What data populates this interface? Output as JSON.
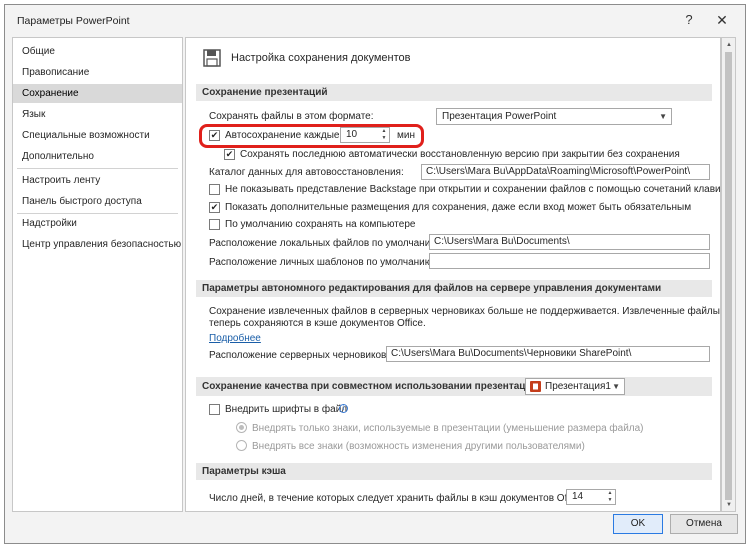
{
  "window": {
    "title": "Параметры PowerPoint",
    "help": "?",
    "close": "✕"
  },
  "sidebar": {
    "items": [
      "Общие",
      "Правописание",
      "Сохранение",
      "Язык",
      "Специальные возможности",
      "Дополнительно",
      "Настроить ленту",
      "Панель быстрого доступа",
      "Надстройки",
      "Центр управления безопасностью"
    ],
    "active": "Сохранение"
  },
  "content": {
    "heading": "Настройка сохранения документов",
    "save_section": {
      "header": "Сохранение презентаций",
      "format_label": "Сохранять файлы в этом формате:",
      "format_value": "Презентация PowerPoint",
      "autosave_label": "Автосохранение каждые",
      "autosave_value": "10",
      "autosave_unit": "мин",
      "autosave_checked": true,
      "keep_last_label": "Сохранять последнюю автоматически восстановленную версию при закрытии без сохранения",
      "keep_last_checked": true,
      "recovery_label": "Каталог данных для автовосстановления:",
      "recovery_value": "C:\\Users\\Mara Bu\\AppData\\Roaming\\Microsoft\\PowerPoint\\",
      "backstage_label": "Не показывать представление Backstage при открытии и сохранении файлов с помощью сочетаний клавиш",
      "backstage_checked": false,
      "more_places_label": "Показать дополнительные размещения для сохранения, даже если вход может быть обязательным",
      "more_places_checked": true,
      "default_computer_label": "По умолчанию сохранять на компьютере",
      "default_computer_checked": false,
      "local_files_label": "Расположение локальных файлов по умолчанию:",
      "local_files_value": "C:\\Users\\Mara Bu\\Documents\\",
      "personal_templates_label": "Расположение личных шаблонов по умолчанию:",
      "personal_templates_value": ""
    },
    "offline_section": {
      "header": "Параметры автономного редактирования для файлов на сервере управления документами",
      "note_line1": "Сохранение извлеченных файлов в серверных черновиках больше не поддерживается. Извлеченные файлы",
      "note_line2": "теперь сохраняются в кэше документов Office.",
      "more_link": "Подробнее",
      "drafts_label": "Расположение серверных черновиков:",
      "drafts_value": "C:\\Users\\Mara Bu\\Documents\\Черновики SharePoint\\"
    },
    "quality_section": {
      "header": "Сохранение качества при совместном использовании презентации:",
      "presentation_value": "Презентация1",
      "embed_fonts_label": "Внедрить шрифты в файл",
      "embed_fonts_checked": false,
      "embed_used_label": "Внедрять только знаки, используемые в презентации (уменьшение размера файла)",
      "embed_all_label": "Внедрять все знаки (возможность изменения другими пользователями)",
      "embed_used_selected": true
    },
    "cache_section": {
      "header": "Параметры кэша",
      "days_label": "Число дней, в течение которых следует хранить файлы в кэш документов Office:",
      "days_value": "14"
    }
  },
  "buttons": {
    "ok": "OK",
    "cancel": "Отмена"
  },
  "colors": {
    "highlight": "#e0201b",
    "active_nav": "#d9d9d9",
    "link": "#1a5ea8",
    "ppt_icon": "#c43e1c"
  }
}
